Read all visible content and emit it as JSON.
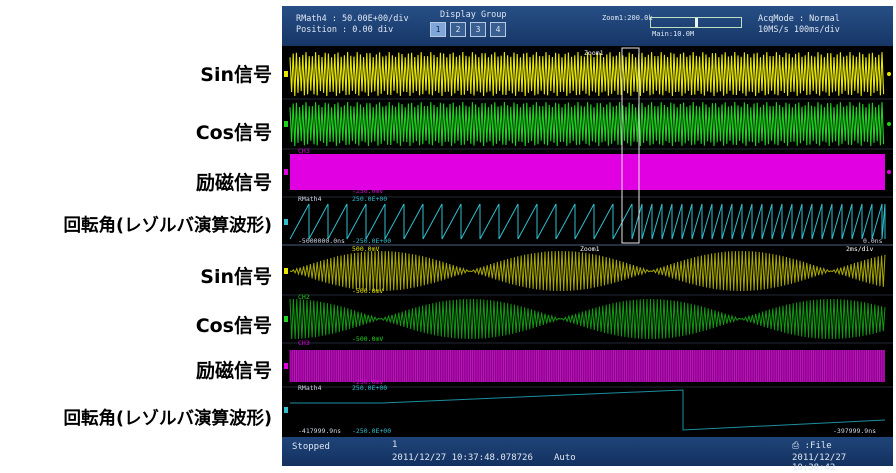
{
  "labels": [
    "Sin信号",
    "Cos信号",
    "励磁信号",
    "回転角(レゾルバ演算波形)",
    "Sin信号",
    "Cos信号",
    "励磁信号",
    "回転角(レゾルバ演算波形)"
  ],
  "header": {
    "trace_line": "RMath4   : 50.00E+00/div",
    "position_line": "Position : 0.00 div",
    "display_group_label": "Display Group",
    "group_buttons": [
      "1",
      "2",
      "3",
      "4"
    ],
    "zoom_label": "Zoom1:200.0k",
    "main_label": "Main:10.0M",
    "acq_mode_line": "AcqMode : Normal",
    "rate_line": "10MS/s   100ms/div"
  },
  "overlays": {
    "zoom1_marker": "Zoom1",
    "ch3_tag": "CH3",
    "ch3_neg": "-250.0mV",
    "rmath_tag": "RMath4",
    "rmath_top": "250.0E+00",
    "rmath_neg": "-250.0E+00",
    "time_left": "-5000000.0ns",
    "time_right": "0.0ns",
    "zoom_top_level": "500.0mV",
    "zoom_marker": "Zoom1",
    "zoom_rate": "2ms/div",
    "ch1_neg": "-500.0mV",
    "ch2_tag": "CH2",
    "ch2_neg": "-500.0mV",
    "zch3_tag": "CH3",
    "zch3_neg": "-250.0mV",
    "zrmath_tag": "RMath4",
    "zrmath_top": "250.0E+00",
    "zrmath_neg": "-250.0E+00",
    "ztime_left": "-417999.9ns",
    "ztime_right": "-397999.9ns"
  },
  "footer": {
    "status": "Stopped",
    "record_no": "1",
    "trigger_time": "2011/12/27 10:37:48.078726",
    "mode": "Auto",
    "save_target": "File",
    "clock": "2011/12/27 10:38:42"
  },
  "colors": {
    "ch1": "#e8e800",
    "ch2": "#1ed21e",
    "ch3": "#e100e1",
    "math": "#2fbfcf",
    "ch1_zoom": "#a8a800",
    "ch2_zoom": "#149914",
    "ch3_zoom": "#8e008e",
    "math_zoom": "#1b8fa0"
  }
}
